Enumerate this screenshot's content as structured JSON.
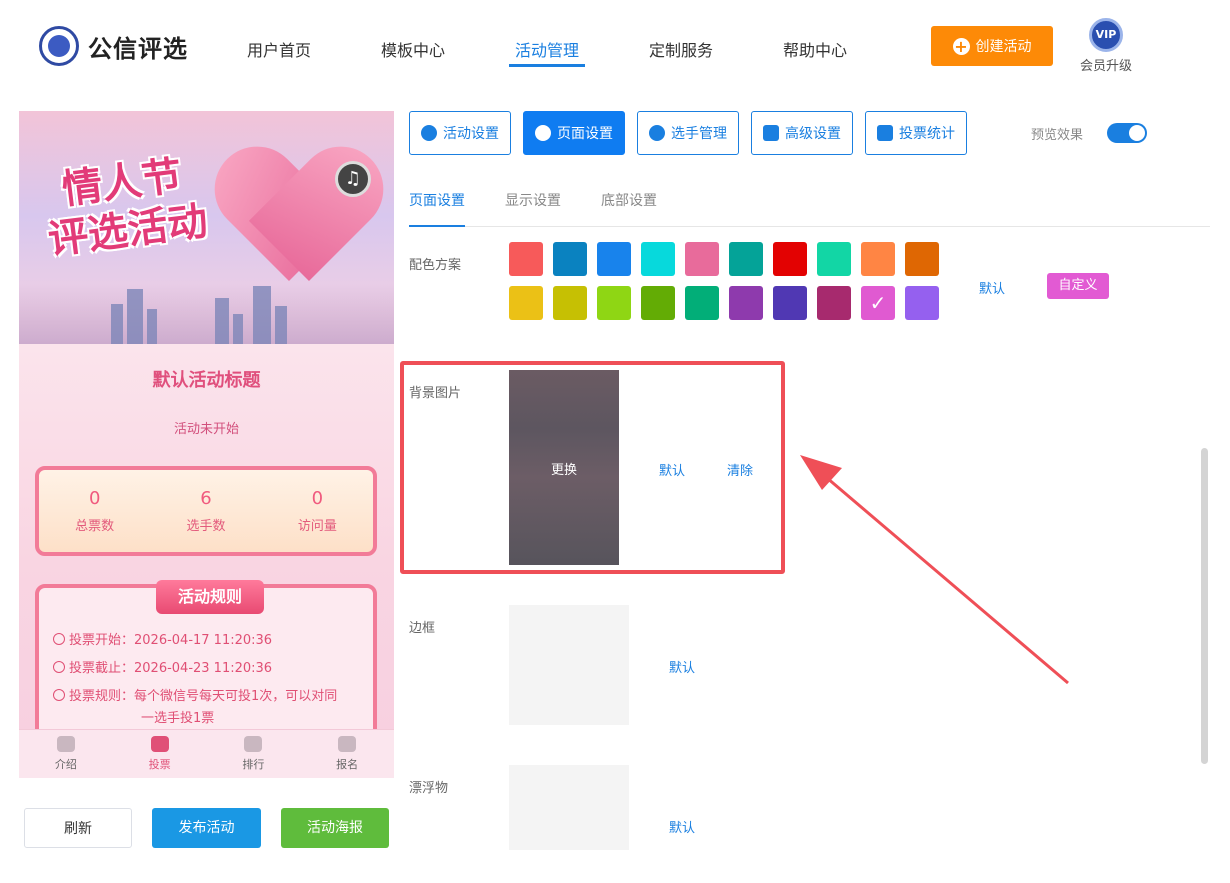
{
  "header": {
    "brand": "公信评选",
    "nav": [
      "用户首页",
      "模板中心",
      "活动管理",
      "定制服务",
      "帮助中心"
    ],
    "active_nav": "活动管理",
    "create_button": "创建活动",
    "vip_badge": "VIP",
    "vip_label": "会员升级"
  },
  "preview": {
    "banner_title_line1": "情人节",
    "banner_title_line2": "评选活动",
    "activity_title": "默认活动标题",
    "activity_status": "活动未开始",
    "stats": [
      {
        "value": "0",
        "label": "总票数"
      },
      {
        "value": "6",
        "label": "选手数"
      },
      {
        "value": "0",
        "label": "访问量"
      }
    ],
    "rules_title": "活动规则",
    "rules": [
      "投票开始：2026-04-17 11:20:36",
      "投票截止：2026-04-23 11:20:36",
      "投票规则：每个微信号每天可投1次，可以对同",
      "一选手投1票"
    ],
    "tabs": [
      {
        "label": "介绍",
        "active": false
      },
      {
        "label": "投票",
        "active": true
      },
      {
        "label": "排行",
        "active": false
      },
      {
        "label": "报名",
        "active": false
      }
    ]
  },
  "bottom_buttons": {
    "refresh": "刷新",
    "publish": "发布活动",
    "poster": "活动海报"
  },
  "toolbar": {
    "buttons": [
      {
        "label": "活动设置",
        "icon": "star-icon",
        "active": false
      },
      {
        "label": "页面设置",
        "icon": "gear-icon",
        "active": true
      },
      {
        "label": "选手管理",
        "icon": "users-icon",
        "active": false
      },
      {
        "label": "高级设置",
        "icon": "advanced-gear-icon",
        "active": false
      },
      {
        "label": "投票统计",
        "icon": "bar-chart-icon",
        "active": false
      }
    ],
    "preview_label": "预览效果",
    "preview_on": true
  },
  "subtabs": {
    "items": [
      "页面设置",
      "显示设置",
      "底部设置"
    ],
    "active": "页面设置"
  },
  "color_scheme": {
    "label": "配色方案",
    "colors": [
      "#f75a5a",
      "#0a82c0",
      "#1883ec",
      "#07d9dc",
      "#e86b9b",
      "#04a398",
      "#e30202",
      "#12d6a5",
      "#ff8544",
      "#df6703",
      "#ebc116",
      "#c6c003",
      "#8fd614",
      "#63ac05",
      "#02ae78",
      "#8e3aad",
      "#5038b3",
      "#a72a6e",
      "#e05ad1",
      "#9560ef"
    ],
    "selected_index": 18,
    "default_link": "默认",
    "custom_button": "自定义"
  },
  "background_image": {
    "label": "背景图片",
    "replace": "更换",
    "default_link": "默认",
    "clear_link": "清除"
  },
  "border": {
    "label": "边框",
    "default_link": "默认"
  },
  "floater": {
    "label": "漂浮物",
    "default_link": "默认"
  }
}
